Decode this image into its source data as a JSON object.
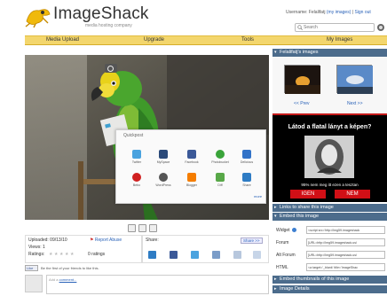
{
  "header": {
    "logo_text": "ImageShack",
    "logo_tagline": "media hosting company",
    "user_links": {
      "username": "Username: Felalifatj",
      "my_images": "(my images)",
      "sign_out": "Sign out"
    },
    "search_placeholder": "Search"
  },
  "nav": {
    "items": [
      {
        "label": "Media Upload"
      },
      {
        "label": "Upgrade"
      },
      {
        "label": "Tools"
      },
      {
        "label": "My Images"
      }
    ]
  },
  "quickpost": {
    "title": "Quickpost",
    "row1": [
      {
        "label": "Twitter",
        "icon": "twitter-icon",
        "color": "#4aa3df"
      },
      {
        "label": "MySpace",
        "icon": "myspace-icon",
        "color": "#2b4a7a"
      },
      {
        "label": "Facebook",
        "icon": "facebook-icon",
        "color": "#3b5998"
      },
      {
        "label": "Photobucket",
        "icon": "photobucket-icon",
        "color": "#3aa43a"
      },
      {
        "label": "Delicious",
        "icon": "delicious-icon",
        "color": "#3273c8"
      }
    ],
    "row2": [
      {
        "label": "Bebo",
        "icon": "bebo-icon",
        "color": "#d02020"
      },
      {
        "label": "WordPress",
        "icon": "wordpress-icon",
        "color": "#555555"
      },
      {
        "label": "Blogger",
        "icon": "blogger-icon",
        "color": "#f57d00"
      },
      {
        "label": "Diff",
        "icon": "diff-icon",
        "color": "#58a848"
      },
      {
        "label": "Share",
        "icon": "share-icon",
        "color": "#2e7cc4"
      }
    ],
    "more": "more"
  },
  "stats": {
    "uploaded": "Uploaded: 09/13/10",
    "report": "Report Abuse",
    "views": "Views: 1",
    "ratings_label": "Ratings:",
    "ratings_count": "0 ratings"
  },
  "share": {
    "label": "Share:",
    "button": "Share >>"
  },
  "likebar": {
    "like": "Like",
    "text": "Be the first of your friends to like this."
  },
  "comment": {
    "prefix": "Add a",
    "link": "comment..."
  },
  "right": {
    "user_images_title": "Felalifatj's images",
    "prev": "<< Prev",
    "next": "Next >>",
    "ad": {
      "title": "Látod a flatal lányt a képen?",
      "subtitle": "95% nem meg itt ezen a tesztan",
      "yes": "IGEN",
      "no": "NEM"
    },
    "links_title": "Links to share this image",
    "embed_title": "Embed this image",
    "embed_rows": [
      {
        "label": "Widget",
        "value": "<script src='http://img59.imageshack"
      },
      {
        "label": "Forum",
        "value": "[URL=http://img59.imageshack.us/"
      },
      {
        "label": "Alt Forum",
        "value": "[URL=http://img59.imageshack.us/"
      },
      {
        "label": "HTML",
        "value": "<a target='_blank' title='ImageShac"
      }
    ],
    "embed_thumbs_title": "Embed thumbnails of this image",
    "details_title": "Image Details"
  },
  "colors": {
    "nav_bg": "#f3d66d",
    "section_head": "#4c6c8c",
    "ad_red": "#d10f16",
    "link_blue": "#2a62b8"
  }
}
